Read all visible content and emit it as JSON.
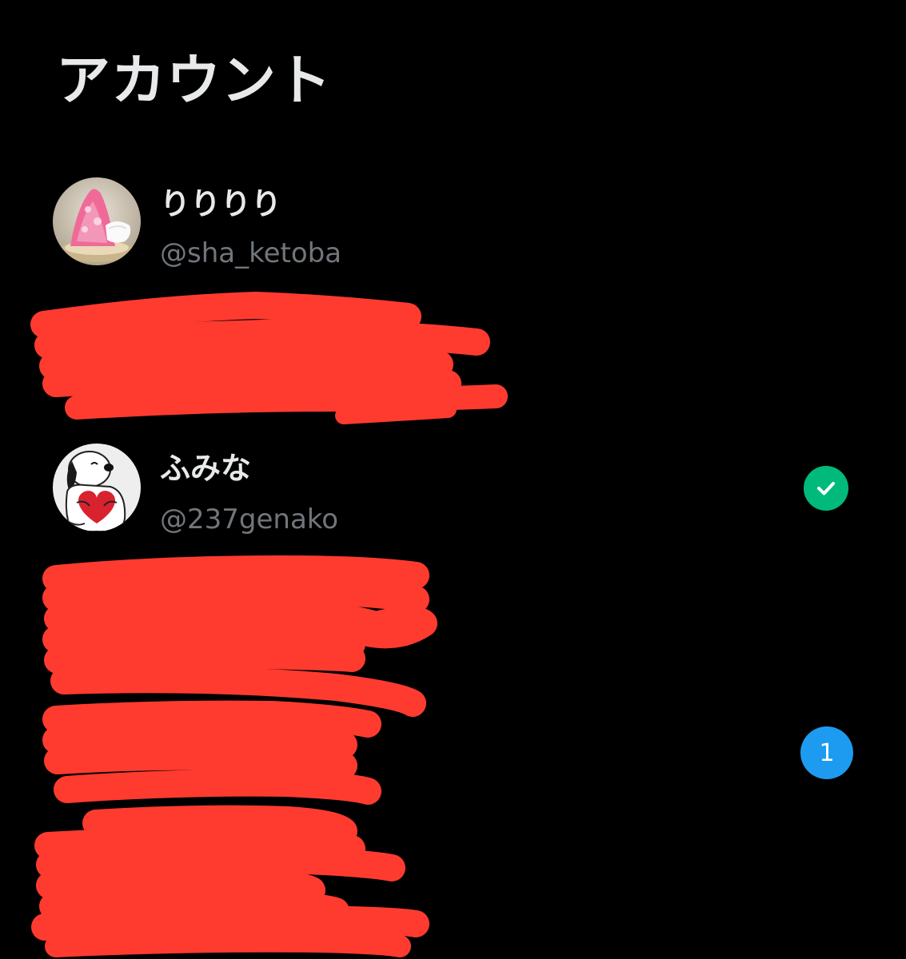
{
  "page": {
    "title": "アカウント"
  },
  "accounts": [
    {
      "display_name": "りりりり",
      "handle": "@sha_ketoba",
      "avatar_icon": "shaved-ice-dessert-photo"
    },
    {
      "display_name": "ふみな",
      "handle": "@237genako",
      "avatar_icon": "snoopy-heart-photo",
      "status_icon": "check-icon"
    }
  ],
  "notification_badge": {
    "count": "1"
  },
  "colors": {
    "background": "#000000",
    "primary_text": "#e7e9ea",
    "secondary_text": "#71767b",
    "success": "#00ba7c",
    "accent": "#1d9bf0",
    "redaction": "#ff3b30"
  }
}
